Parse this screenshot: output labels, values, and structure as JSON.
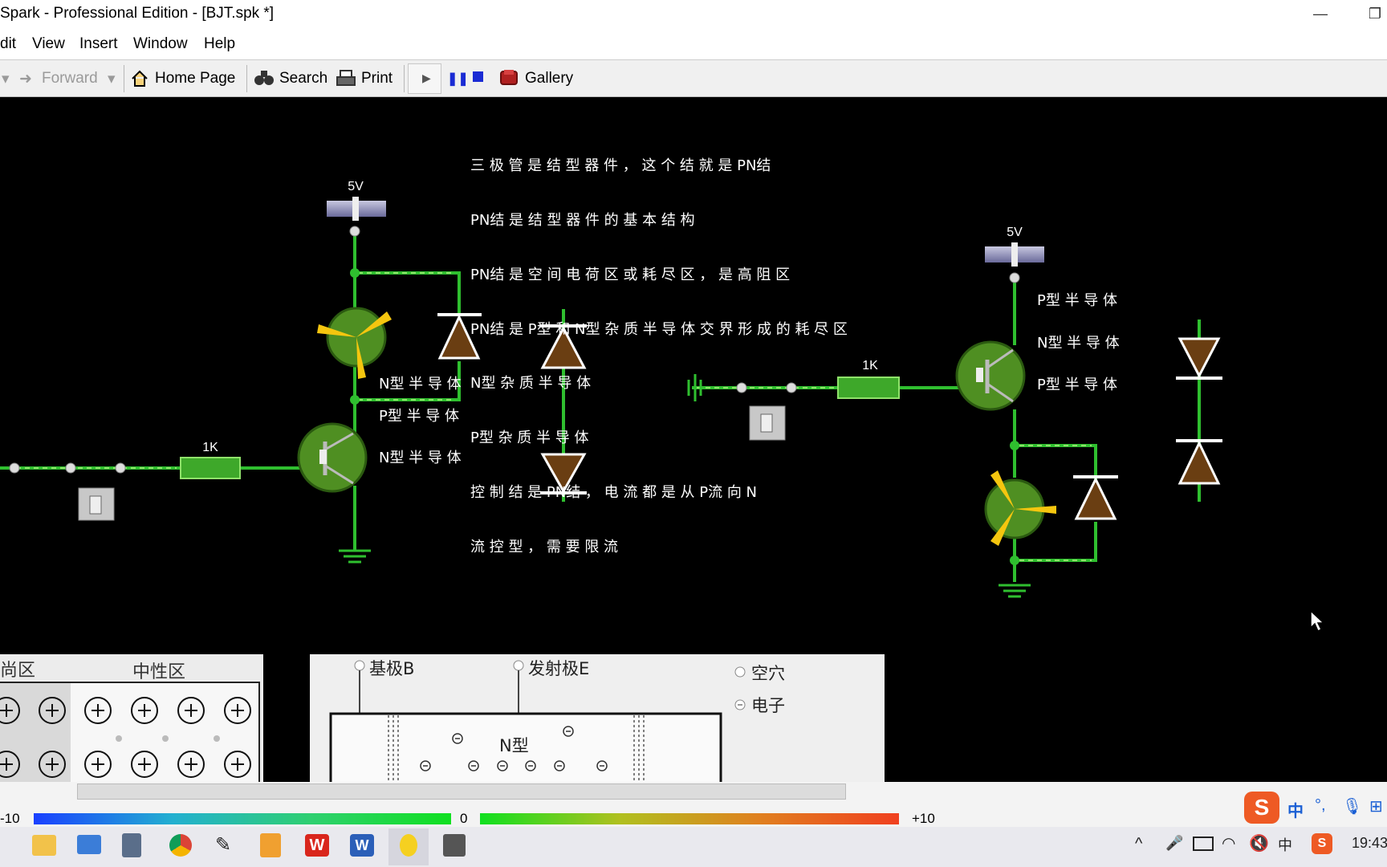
{
  "window": {
    "title": "Spark - Professional Edition - [BJT.spk *]"
  },
  "menu": [
    "dit",
    "View",
    "Insert",
    "Window",
    "Help"
  ],
  "toolbar": {
    "forward": "Forward",
    "home": "Home Page",
    "search": "Search",
    "print": "Print",
    "gallery": "Gallery"
  },
  "notes": [
    "三 极 管 是 结 型 器 件 ， 这 个 结 就 是 PN结",
    "PN结 是 结 型 器 件 的 基 本 结 构",
    "PN结 是 空 间 电 荷 区 或 耗 尽 区 ， 是 高 阻 区",
    "PN结 是 P型 和 N型 杂 质 半 导 体 交 界 形 成 的 耗 尽 区",
    "N型 杂 质 半 导 体",
    "P型 杂 质 半 导 体",
    "控 制 结 是 PN结 ， 电 流 都 是 从 P流 向 N",
    "流 控 型 ， 需 要 限 流"
  ],
  "circuit_left": {
    "supply_label": "5V",
    "resistor_label": "1K",
    "labels": [
      "N型 半 导 体",
      "P型 半 导 体",
      "N型 半 导 体"
    ]
  },
  "circuit_right": {
    "supply_label": "5V",
    "resistor_label": "1K",
    "labels": [
      "P型 半 导 体",
      "N型 半 导 体",
      "P型 半 导 体"
    ]
  },
  "panel_left": {
    "label_a": "尚区",
    "label_b": "中性区"
  },
  "panel_mid": {
    "base": "基极B",
    "emitter": "发射极E",
    "hole": "空穴",
    "electron": "电子",
    "ntype": "N型"
  },
  "scale": {
    "min": "-10",
    "mid": "0",
    "max": "+10"
  },
  "clock": "19:43",
  "ime": {
    "lang": "中"
  },
  "colors": {
    "wire": "#2fbf2f",
    "wire_lite": "#7fdc5f",
    "diode": "#6a3e12",
    "fan": "#f5c60f"
  }
}
